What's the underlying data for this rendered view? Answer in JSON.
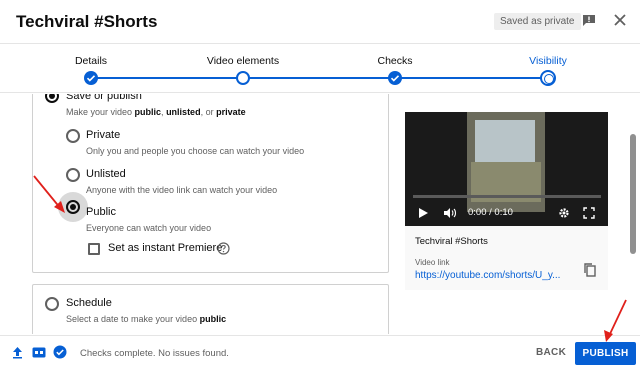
{
  "header": {
    "title": "Techviral #Shorts",
    "saved_badge": "Saved as private"
  },
  "stepper": {
    "steps": [
      {
        "label": "Details",
        "state": "done"
      },
      {
        "label": "Video elements",
        "state": "visited"
      },
      {
        "label": "Checks",
        "state": "done"
      },
      {
        "label": "Visibility",
        "state": "current"
      }
    ]
  },
  "visibility": {
    "save_or_publish": {
      "label": "Save or publish",
      "selected": true,
      "description_parts": [
        "Make your video ",
        "public",
        ", ",
        "unlisted",
        ", or ",
        "private"
      ]
    },
    "options": [
      {
        "label": "Private",
        "description": "Only you and people you choose can watch your video",
        "selected": false
      },
      {
        "label": "Unlisted",
        "description": "Anyone with the video link can watch your video",
        "selected": false
      },
      {
        "label": "Public",
        "description": "Everyone can watch your video",
        "selected": true
      }
    ],
    "premiere": {
      "label": "Set as instant Premiere",
      "checked": false
    },
    "schedule": {
      "label": "Schedule",
      "selected": false,
      "description_parts": [
        "Select a date to make your video ",
        "public"
      ]
    }
  },
  "preview": {
    "time": "0:00 / 0:10",
    "video_title": "Techviral #Shorts",
    "link_label": "Video link",
    "link": "https://youtube.com/shorts/U_y..."
  },
  "footer": {
    "status": "Checks complete. No issues found.",
    "back_label": "BACK",
    "publish_label": "PUBLISH"
  },
  "colors": {
    "accent": "#065fd4",
    "annotation_arrow": "#e0201b"
  }
}
